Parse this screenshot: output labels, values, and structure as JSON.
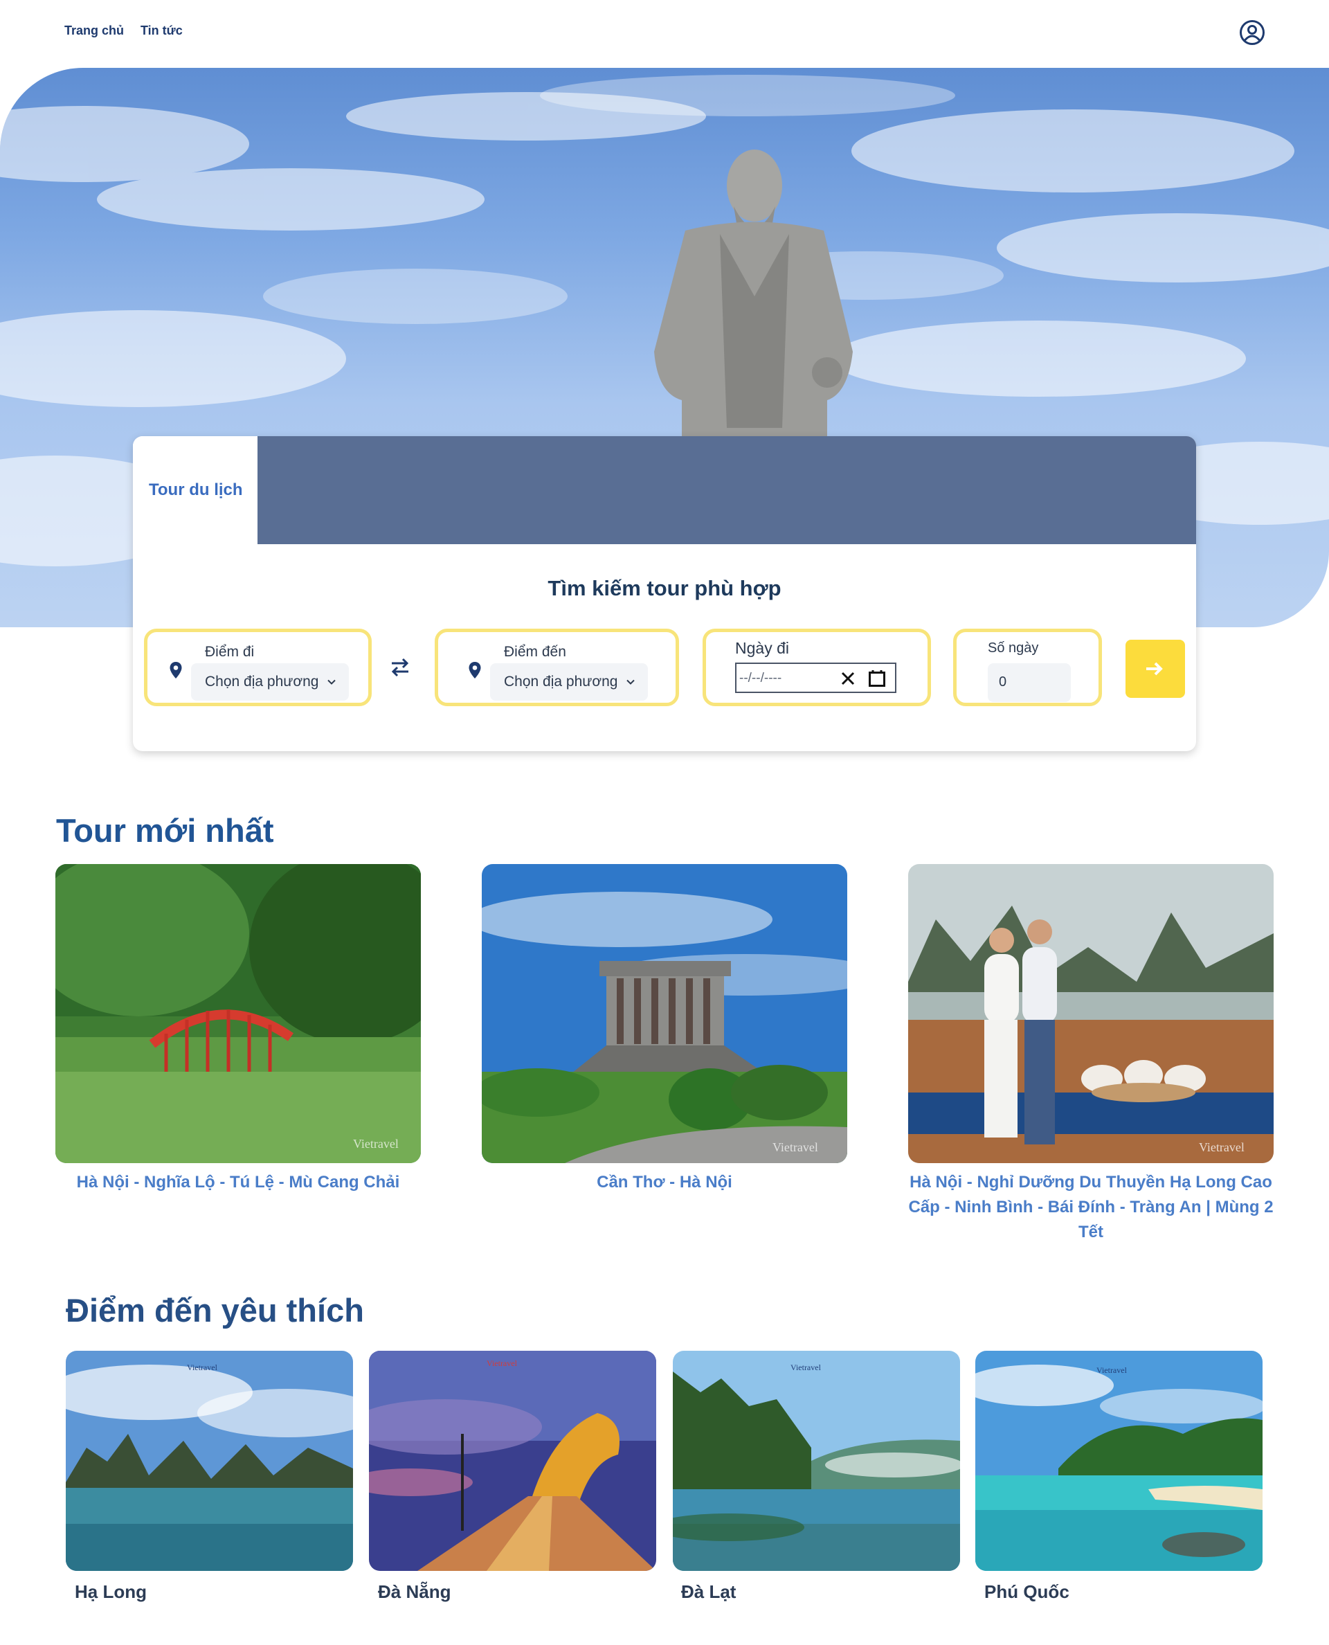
{
  "nav": {
    "home": "Trang chủ",
    "news": "Tin tức"
  },
  "search": {
    "tab": "Tour du lịch",
    "title": "Tìm kiếm tour phù hợp",
    "from_label": "Điểm đi",
    "from_value": "Chọn địa phương",
    "to_label": "Điểm đến",
    "to_value": "Chọn địa phương",
    "date_label": "Ngày đi",
    "date_placeholder": "--/--/----",
    "days_label": "Số ngày",
    "days_value": "0"
  },
  "latest": {
    "heading": "Tour mới nhất",
    "tours": [
      {
        "name": "Hà Nội - Nghĩa Lộ - Tú Lệ - Mù Cang Chải",
        "watermark": "Vietravel"
      },
      {
        "name": "Cần Thơ - Hà Nội",
        "watermark": "Vietravel"
      },
      {
        "name": "Hà Nội - Nghỉ Dưỡng Du Thuyền Hạ Long Cao Cấp - Ninh Bình - Bái Đính - Tràng An | Mùng 2 Tết",
        "watermark": "Vietravel"
      }
    ]
  },
  "favorites": {
    "heading": "Điểm đến yêu thích",
    "places": [
      {
        "name": "Hạ Long",
        "watermark": "Vietravel"
      },
      {
        "name": "Đà Nẵng",
        "watermark": "Vietravel"
      },
      {
        "name": "Đà Lạt",
        "watermark": "Vietravel"
      },
      {
        "name": "Phú Quốc",
        "watermark": "Vietravel"
      }
    ]
  },
  "colors": {
    "accent_yellow": "#fcdc3c",
    "field_border": "#f8e47a",
    "heading_blue": "#215595",
    "link_blue": "#4a7dc8"
  }
}
